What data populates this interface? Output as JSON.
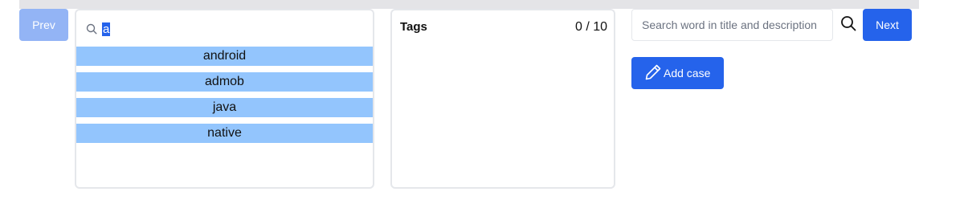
{
  "nav": {
    "prev_label": "Prev",
    "next_label": "Next"
  },
  "tag_search": {
    "query": "a",
    "options": [
      "android",
      "admob",
      "java",
      "native"
    ]
  },
  "tags_panel": {
    "title": "Tags",
    "count": "0 / 10"
  },
  "search": {
    "placeholder": "Search word in title and description",
    "icon": "search-icon"
  },
  "actions": {
    "add_case_label": "Add case",
    "add_case_icon": "pencil-icon"
  },
  "colors": {
    "primary": "#2563eb",
    "primary_disabled": "#93b4f5",
    "tag_option_bg": "#93c5fd",
    "border": "#e5e7eb"
  }
}
